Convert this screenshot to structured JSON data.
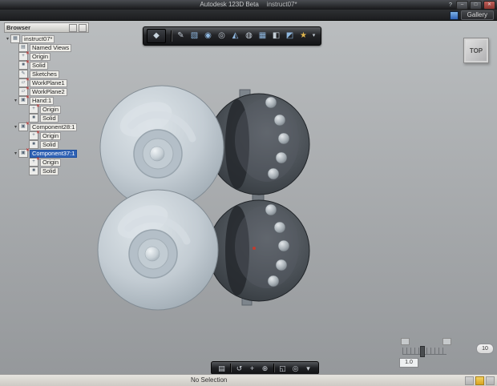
{
  "colors": {
    "selection": "#2f62b5",
    "canvas_top": "#babdbf",
    "canvas_bottom": "#95989b",
    "toolbar_dark": "#232427",
    "warning": "#d9a520"
  },
  "titlebar": {
    "app_title": "Autodesk 123D Beta",
    "doc_title": "instruct07*",
    "help_glyph": "?",
    "minimize_glyph": "–",
    "maximize_glyph": "□",
    "close_glyph": "✕"
  },
  "menubar": {
    "gallery_label": "Gallery"
  },
  "glyphs": {
    "expanded": "▾",
    "hidden": "✕",
    "assembly": "▦",
    "views": "▤",
    "origin": "+",
    "solid": "■",
    "sketch": "✎",
    "workplane": "▱",
    "component": "▣"
  },
  "browser": {
    "title": "Browser",
    "tree": [
      {
        "label": "instruct07*"
      },
      {
        "label": "Named Views"
      },
      {
        "label": "Origin"
      },
      {
        "label": "Solid"
      },
      {
        "label": "Sketches"
      },
      {
        "label": "WorkPlane1"
      },
      {
        "label": "WorkPlane2"
      },
      {
        "label": "Hand:1"
      },
      {
        "label": "Origin"
      },
      {
        "label": "Solid"
      },
      {
        "label": "Component28:1"
      },
      {
        "label": "Origin"
      },
      {
        "label": "Solid"
      },
      {
        "label": "Component37:1"
      },
      {
        "label": "Origin"
      },
      {
        "label": "Solid"
      }
    ]
  },
  "main_toolbar": {
    "icons": [
      {
        "name": "app-menu-icon",
        "glyph": "◆"
      },
      {
        "name": "sketch-tool-icon",
        "glyph": "✎"
      },
      {
        "name": "box-tool-icon",
        "glyph": "▧"
      },
      {
        "name": "sphere-tool-icon",
        "glyph": "◉"
      },
      {
        "name": "cylinder-tool-icon",
        "glyph": "◎"
      },
      {
        "name": "cone-tool-icon",
        "glyph": "◭"
      },
      {
        "name": "torus-tool-icon",
        "glyph": "◍"
      },
      {
        "name": "pattern-tool-icon",
        "glyph": "▦"
      },
      {
        "name": "combine-tool-icon",
        "glyph": "◧"
      },
      {
        "name": "material-tool-icon",
        "glyph": "◩"
      },
      {
        "name": "snapshot-tool-icon",
        "glyph": "★"
      },
      {
        "name": "more-tools-icon",
        "glyph": "▾"
      }
    ]
  },
  "viewcube": {
    "face": "TOP"
  },
  "nav_toolbar": {
    "icons": [
      {
        "name": "nav-menu-icon",
        "glyph": "▤"
      },
      {
        "name": "orbit-icon",
        "glyph": "↺"
      },
      {
        "name": "pan-icon",
        "glyph": "+"
      },
      {
        "name": "zoom-icon",
        "glyph": "⊕"
      },
      {
        "name": "fit-view-icon",
        "glyph": "◱"
      },
      {
        "name": "look-at-icon",
        "glyph": "◎"
      },
      {
        "name": "display-settings-icon",
        "glyph": "▾"
      }
    ]
  },
  "scale_widget": {
    "value": "1.0",
    "preset": "10"
  },
  "statusbar": {
    "text": "No Selection"
  }
}
